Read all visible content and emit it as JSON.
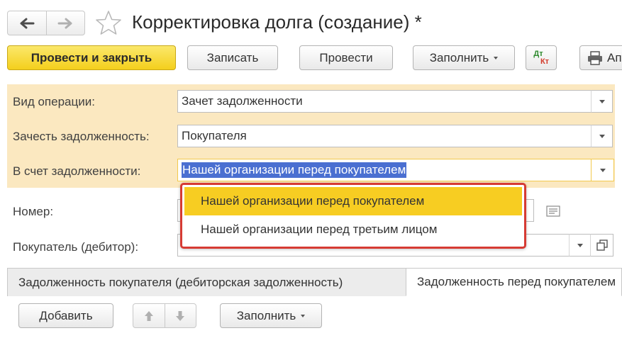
{
  "header": {
    "title": "Корректировка долга (создание) *"
  },
  "toolbar": {
    "post_close": "Провести и закрыть",
    "save": "Записать",
    "post": "Провести",
    "fill": "Заполнить",
    "dtkt_top": "Дт",
    "dtkt_bottom": "Кт",
    "print_partial": "Ап"
  },
  "form": {
    "operation_label": "Вид операции:",
    "operation_value": "Зачет задолженности",
    "offset_label": "Зачесть задолженность:",
    "offset_value": "Покупателя",
    "against_label": "В счет задолженности:",
    "against_value": "Нашей организации перед покупателем",
    "number_label": "Номер:",
    "buyer_label": "Покупатель (дебитор):"
  },
  "dropdown": {
    "options": [
      "Нашей организации перед покупателем",
      "Нашей организации перед третьим лицом"
    ],
    "selected_index": 0
  },
  "tabs": [
    "Задолженность покупателя (дебиторская задолженность)",
    "Задолженность перед покупателем"
  ],
  "tab_toolbar": {
    "add": "Добавить",
    "fill": "Заполнить"
  }
}
